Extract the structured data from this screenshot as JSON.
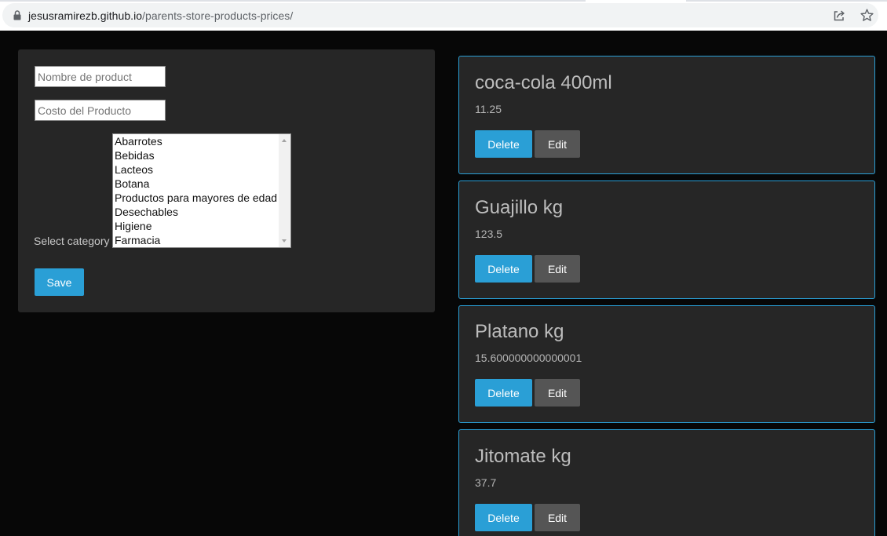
{
  "browser": {
    "url_host": "jesusramirezb.github.io",
    "url_path": "/parents-store-products-prices/"
  },
  "form": {
    "name_placeholder": "Nombre de product",
    "cost_placeholder": "Costo del Producto",
    "select_label": "Select category",
    "categories": [
      "Abarrotes",
      "Bebidas",
      "Lacteos",
      "Botana",
      "Productos para mayores de edad",
      "Desechables",
      "Higiene",
      "Farmacia"
    ],
    "save_label": "Save"
  },
  "products": [
    {
      "name": "coca-cola 400ml",
      "price": "11.25",
      "delete_label": "Delete",
      "edit_label": "Edit"
    },
    {
      "name": "Guajillo kg",
      "price": "123.5",
      "delete_label": "Delete",
      "edit_label": "Edit"
    },
    {
      "name": "Platano kg",
      "price": "15.600000000000001",
      "delete_label": "Delete",
      "edit_label": "Edit"
    },
    {
      "name": "Jitomate kg",
      "price": "37.7",
      "delete_label": "Delete",
      "edit_label": "Edit"
    }
  ],
  "colors": {
    "accent": "#2a9fd6",
    "panel": "#262626",
    "background": "#070707",
    "secondary_button": "#555555"
  }
}
